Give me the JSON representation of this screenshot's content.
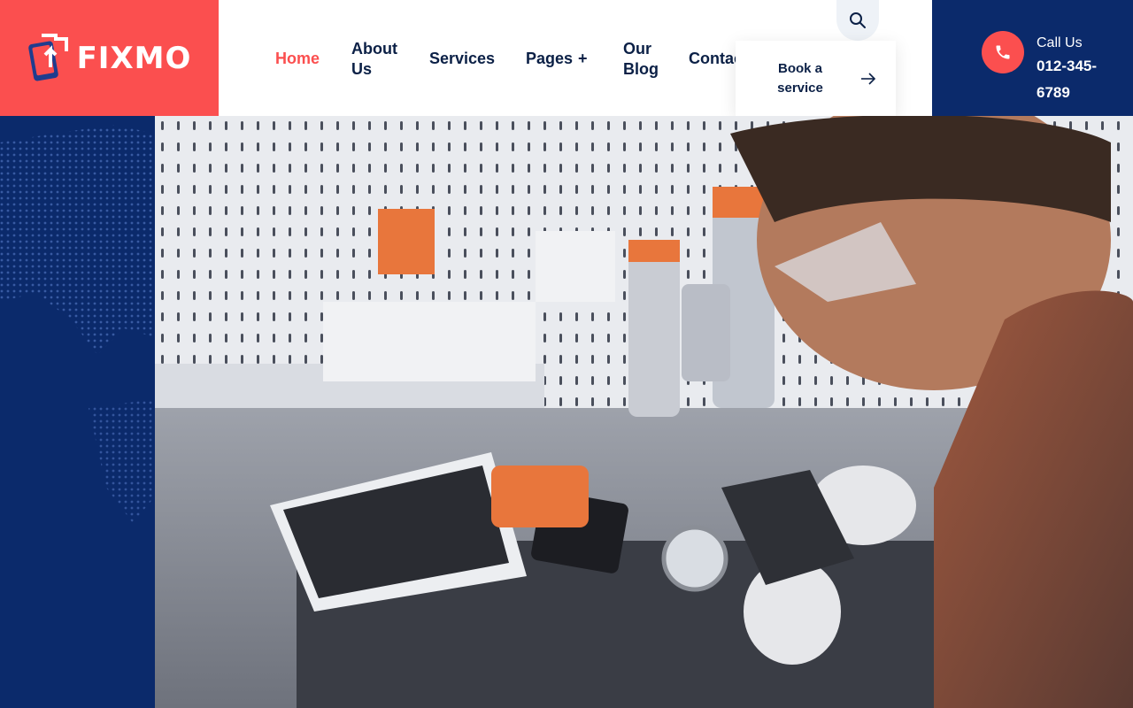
{
  "brand": {
    "name": "FIXMO",
    "color": "#fb4f4f"
  },
  "nav": {
    "items": [
      {
        "label": "Home",
        "active": true
      },
      {
        "label": "About Us"
      },
      {
        "label": "Services"
      },
      {
        "label": "Pages"
      },
      {
        "label": "Our Blog"
      },
      {
        "label": "Contact"
      }
    ],
    "pages_plus": "+",
    "search_icon": "search-icon"
  },
  "book": {
    "label": "Book a service",
    "icon": "arrow-right-icon"
  },
  "call": {
    "label": "Call Us",
    "number": "012-345-6789",
    "icon": "phone-icon"
  },
  "hero": {
    "image": "technician repairing smartphone at workbench"
  },
  "colors": {
    "accent": "#fb4f4f",
    "navy": "#0b2a6b",
    "text": "#0b2046"
  }
}
